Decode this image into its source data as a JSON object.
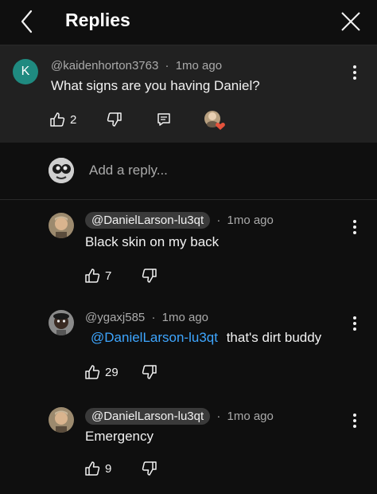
{
  "header": {
    "title": "Replies"
  },
  "parent_comment": {
    "avatar_letter": "K",
    "author": "@kaidenhorton3763",
    "separator": "·",
    "time": "1mo ago",
    "text": "What signs are you having Daniel?",
    "likes": "2"
  },
  "composer": {
    "placeholder": "Add a reply..."
  },
  "replies": [
    {
      "author": "@DanielLarson-lu3qt",
      "separator": "·",
      "time": "1mo ago",
      "text": "Black skin on my back",
      "likes": "7"
    },
    {
      "author": "@ygaxj585",
      "separator": "·",
      "time": "1mo ago",
      "mention": "@DanielLarson-lu3qt",
      "text": "that's dirt buddy",
      "likes": "29"
    },
    {
      "author": "@DanielLarson-lu3qt",
      "separator": "·",
      "time": "1mo ago",
      "text": "Emergency",
      "likes": "9"
    }
  ],
  "colors": {
    "background": "#0f0f0f",
    "parent_background": "#212121",
    "mention": "#3ea6ff",
    "avatar_k": "#1f8a80",
    "heart": "#e5533c"
  }
}
